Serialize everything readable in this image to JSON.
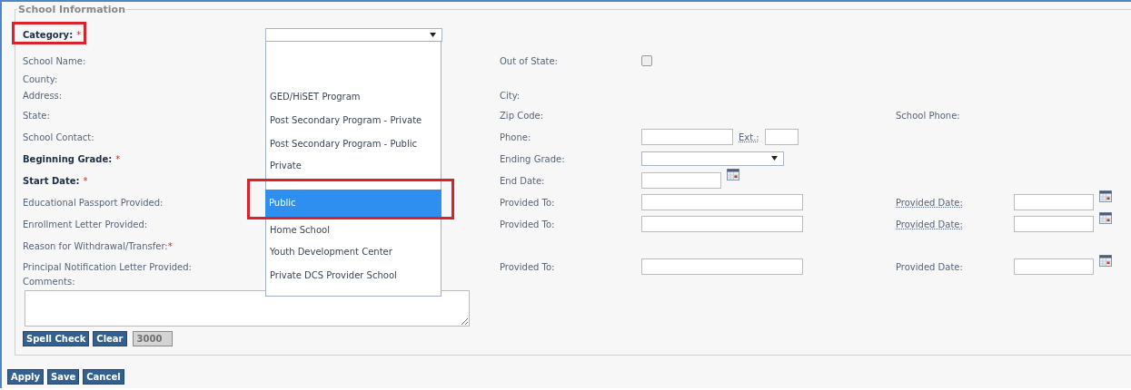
{
  "section": {
    "title": "School Information"
  },
  "rows": [
    {
      "label": "Category:",
      "required_mark": "*",
      "bold": true,
      "annotated": true,
      "control": {
        "kind": "dropdown"
      }
    },
    {
      "label": "School Name:",
      "bold": false,
      "middle": {
        "label": "Out of State:",
        "control": {
          "kind": "checkbox",
          "checked": false
        }
      }
    },
    {
      "label": "County:",
      "bold": false
    },
    {
      "label": "Address:",
      "bold": false,
      "middle": {
        "label": "City:"
      }
    },
    {
      "label": "State:",
      "bold": false,
      "middle": {
        "label": "Zip Code:"
      },
      "right": {
        "label": "School Phone:"
      }
    },
    {
      "label": "School Contact:",
      "bold": false,
      "middle": {
        "label": "Phone:",
        "control": {
          "kind": "phone",
          "ext_label": "Ext.:"
        }
      }
    },
    {
      "label": "Beginning Grade:",
      "required_mark": "*",
      "bold": true,
      "middle": {
        "label": "Ending Grade:",
        "control": {
          "kind": "select"
        }
      }
    },
    {
      "label": "Start Date:",
      "required_mark": "*",
      "bold": true,
      "middle": {
        "label": "End Date:",
        "control": {
          "kind": "date"
        }
      }
    },
    {
      "label": "Educational Passport Provided:",
      "bold": false,
      "middle": {
        "label": "Provided To:",
        "control": {
          "kind": "text"
        }
      },
      "right": {
        "label": "Provided Date:",
        "link": true,
        "control": {
          "kind": "date"
        }
      }
    },
    {
      "label": "Enrollment Letter Provided:",
      "bold": false,
      "middle": {
        "label": "Provided To:",
        "control": {
          "kind": "text"
        }
      },
      "right": {
        "label": "Provided Date:",
        "link": true,
        "control": {
          "kind": "date"
        }
      }
    },
    {
      "label": "Reason for Withdrawal/Transfer:",
      "required_mark": "*",
      "bold": false
    },
    {
      "label": "Principal Notification Letter Provided:",
      "bold": false,
      "middle": {
        "label": "Provided To:",
        "control": {
          "kind": "text"
        }
      },
      "right": {
        "label": "Provided Date:",
        "link": false,
        "control": {
          "kind": "date"
        }
      }
    }
  ],
  "category_options": [
    {
      "selected": false
    },
    {
      "label": "GED/HiSET Program",
      "selected": false
    },
    {
      "label": "Post Secondary Program - Private",
      "selected": false
    },
    {
      "label": "Post Secondary Program - Public",
      "selected": false
    },
    {
      "label": "Private",
      "selected": false
    },
    {
      "label": "Public",
      "selected": true,
      "annotated": true
    },
    {
      "label": "Home School",
      "selected": false
    },
    {
      "label": "Youth Development Center",
      "selected": false
    },
    {
      "label": "Private DCS Provider School",
      "selected": false
    }
  ],
  "comments": {
    "label": "Comments:",
    "counter": "3000"
  },
  "comment_buttons": [
    "Spell Check",
    "Clear"
  ],
  "form_buttons": [
    "Apply",
    "Save",
    "Cancel"
  ]
}
